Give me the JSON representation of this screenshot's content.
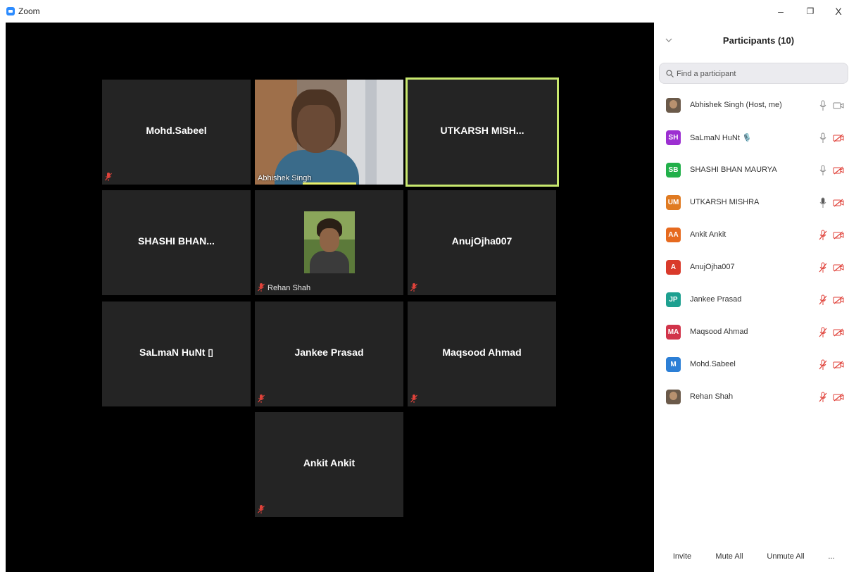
{
  "window": {
    "title": "Zoom",
    "minimize_label": "–",
    "maximize_label": "❐",
    "close_label": "X"
  },
  "gallery": {
    "tiles": [
      {
        "name": "Mohd.Sabeel",
        "muted": true
      },
      {
        "name": "Abhishek Singh",
        "camera_on": true,
        "label": "Abhishek Singh"
      },
      {
        "name": "UTKARSH  MISH...",
        "active_speaker": true
      },
      {
        "name": "SHASHI  BHAN..."
      },
      {
        "name": "Rehan Shah",
        "profile_photo": true,
        "label": "Rehan Shah",
        "muted": true
      },
      {
        "name": "AnujOjha007",
        "muted": true
      },
      {
        "name": "SaLmaN  HuNt ▯"
      },
      {
        "name": "Jankee Prasad",
        "muted": true
      },
      {
        "name": "Maqsood Ahmad",
        "muted": true
      },
      {
        "name": "Ankit Ankit",
        "muted": true
      }
    ]
  },
  "panel": {
    "title": "Participants (10)",
    "search_placeholder": "Find a participant",
    "participants": [
      {
        "name": "Abhishek Singh (Host, me)",
        "avatar": "photo",
        "mic": "on",
        "video": "on"
      },
      {
        "name": "SaLmaN HuNt 🎙️",
        "initials": "SH",
        "color": "#9c2fd1",
        "mic": "on",
        "video": "off"
      },
      {
        "name": "SHASHI BHAN MAURYA",
        "initials": "SB",
        "color": "#22b04a",
        "mic": "on",
        "video": "off"
      },
      {
        "name": "UTKARSH MISHRA",
        "initials": "UM",
        "color": "#e07b22",
        "mic": "speaking",
        "video": "off"
      },
      {
        "name": "Ankit Ankit",
        "initials": "AA",
        "color": "#e66a1f",
        "mic": "muted",
        "video": "off"
      },
      {
        "name": "AnujOjha007",
        "initials": "A",
        "color": "#d93a2b",
        "mic": "muted",
        "video": "off"
      },
      {
        "name": "Jankee Prasad",
        "initials": "JP",
        "color": "#1ea090",
        "mic": "muted",
        "video": "off"
      },
      {
        "name": "Maqsood Ahmad",
        "initials": "MA",
        "color": "#d1344a",
        "mic": "muted",
        "video": "off"
      },
      {
        "name": "Mohd.Sabeel",
        "initials": "M",
        "color": "#2c7fd6",
        "mic": "muted",
        "video": "off"
      },
      {
        "name": "Rehan Shah",
        "avatar": "photo",
        "mic": "muted",
        "video": "off"
      }
    ],
    "buttons": {
      "invite": "Invite",
      "mute_all": "Mute All",
      "unmute_all": "Unmute All",
      "more": "..."
    }
  },
  "colors": {
    "active_speaker_border": "#c8e86e",
    "muted_red": "#e0423a",
    "tile_bg": "#242424"
  }
}
